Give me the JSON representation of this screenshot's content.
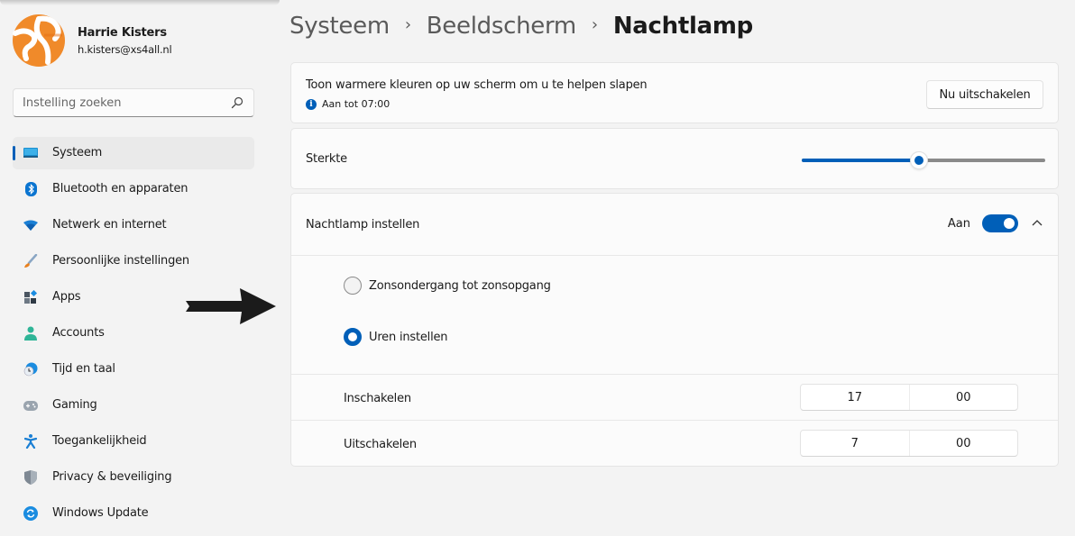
{
  "user": {
    "name": "Harrie Kisters",
    "email": "h.kisters@xs4all.nl",
    "avatar_colors": {
      "primary": "#f08a2a",
      "secondary": "#ffffff"
    }
  },
  "search": {
    "placeholder": "Instelling zoeken",
    "value": ""
  },
  "sidebar": {
    "items": [
      {
        "label": "Systeem",
        "icon": "monitor-icon",
        "active": true
      },
      {
        "label": "Bluetooth en apparaten",
        "icon": "bluetooth-icon",
        "active": false
      },
      {
        "label": "Netwerk en internet",
        "icon": "wifi-icon",
        "active": false
      },
      {
        "label": "Persoonlijke instellingen",
        "icon": "paintbrush-icon",
        "active": false
      },
      {
        "label": "Apps",
        "icon": "apps-icon",
        "active": false
      },
      {
        "label": "Accounts",
        "icon": "person-icon",
        "active": false
      },
      {
        "label": "Tijd en taal",
        "icon": "clock-globe-icon",
        "active": false
      },
      {
        "label": "Gaming",
        "icon": "gamepad-icon",
        "active": false
      },
      {
        "label": "Toegankelijkheid",
        "icon": "accessibility-icon",
        "active": false
      },
      {
        "label": "Privacy & beveiliging",
        "icon": "shield-icon",
        "active": false
      },
      {
        "label": "Windows Update",
        "icon": "update-icon",
        "active": false
      }
    ]
  },
  "breadcrumb": {
    "items": [
      "Systeem",
      "Beeldscherm"
    ],
    "current": "Nachtlamp",
    "separator": "›"
  },
  "night_light": {
    "description": "Toon warmere kleuren op uw scherm om u te helpen slapen",
    "status": "Aan tot 07:00",
    "turn_off_button": "Nu uitschakelen"
  },
  "strength": {
    "label": "Sterkte",
    "value_fraction": 0.48
  },
  "schedule": {
    "label": "Nachtlamp instellen",
    "toggle_label": "Aan",
    "toggle_on": true,
    "expanded": true,
    "options": [
      {
        "label": "Zonsondergang tot zonsopgang",
        "selected": false
      },
      {
        "label": "Uren instellen",
        "selected": true
      }
    ],
    "turn_on": {
      "label": "Inschakelen",
      "hour": "17",
      "minute": "00"
    },
    "turn_off": {
      "label": "Uitschakelen",
      "hour": "7",
      "minute": "00"
    }
  },
  "colors": {
    "accent": "#005fb8",
    "background": "#f3f3f3",
    "card": "#fbfbfb"
  }
}
